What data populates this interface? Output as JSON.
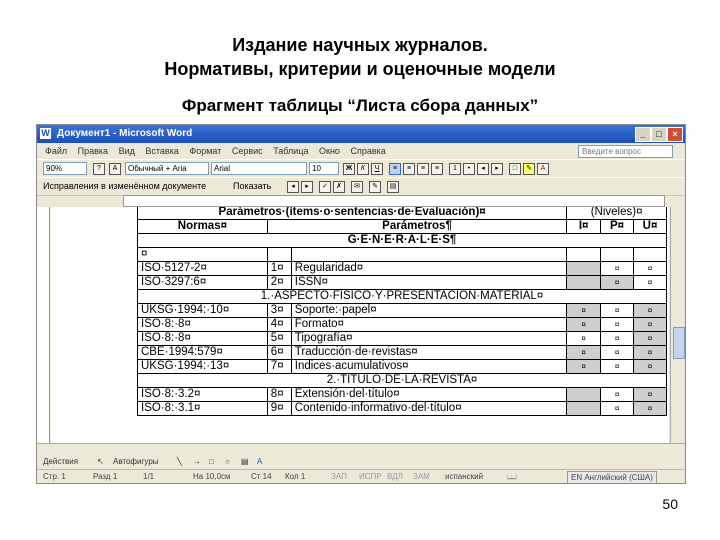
{
  "slide": {
    "title_line1": "Издание научных журналов.",
    "title_line2": "Нормативы, критерии и оценочные модели",
    "subtitle": "Фрагмент таблицы “Листа сбора данных”",
    "page_number": "50"
  },
  "window": {
    "title": "Документ1 - Microsoft Word",
    "btn_min": "_",
    "btn_max": "□",
    "btn_close": "×"
  },
  "menu": [
    "Файл",
    "Правка",
    "Вид",
    "Вставка",
    "Формат",
    "Сервис",
    "Таблица",
    "Окно",
    "Справка"
  ],
  "help_placeholder": "Введите вопрос",
  "toolbar": {
    "zoom": "90%",
    "style": "Обычный + Ariа",
    "font": "Arial",
    "size": "10",
    "track_label": "Исправления в изменённом документе",
    "show_label": "Показать"
  },
  "table": {
    "header1": {
      "params": "Parámetros·(ítems·o·sentencias·de·Evaluación)¤",
      "levels": "(Niveles)¤"
    },
    "header2": {
      "norms": "Normas¤",
      "params": "Parámetros¶",
      "i": "I¤",
      "p": "P¤",
      "u": "U¤"
    },
    "general": "G·E·N·E·R·A·L·E·S¶",
    "rows_a": [
      {
        "norm": "ISO·5127-2¤",
        "num": "1¤",
        "param": "Regularidad¤"
      },
      {
        "norm": "ISO·3297:6¤",
        "num": "2¤",
        "param": "ISSN¤"
      }
    ],
    "section1": "1.·ASPECTO·FISICO·Y·PRESENTACIÓN·MATERIAL¤",
    "rows_b": [
      {
        "norm": "UKSG·1994:·10¤",
        "num": "3¤",
        "param": "Soporte:·papel¤"
      },
      {
        "norm": "ISO·8:·8¤",
        "num": "4¤",
        "param": "Formato¤"
      },
      {
        "norm": "ISO·8:·8¤",
        "num": "5¤",
        "param": "Tipografía¤"
      },
      {
        "norm": "CBE·1994:579¤",
        "num": "6¤",
        "param": "Traducción·de·revistas¤"
      },
      {
        "norm": "UKSG·1994:·13¤",
        "num": "7¤",
        "param": "Indices·acumulativos¤"
      }
    ],
    "section2": "2.·TÍTULO·DE·LA·REVISTA¤",
    "rows_c": [
      {
        "norm": "ISO·8:·3.2¤",
        "num": "8¤",
        "param": "Extensión·del·título¤"
      },
      {
        "norm": "ISO·8:·3.1¤",
        "num": "9¤",
        "param": "Contenido·informativo·del·título¤"
      }
    ],
    "mark": "¤"
  },
  "draw": {
    "actions": "Действия",
    "autoshapes": "Автофигуры"
  },
  "status": {
    "page": "Стр. 1",
    "section": "Разд 1",
    "pages": "1/1",
    "pos": "На 10,0см",
    "line": "Ст 14",
    "col": "Кол 1",
    "rec": "ЗАП",
    "trk": "ИСПР",
    "ext": "ВДЛ",
    "ovr": "ЗАМ",
    "lang_doc": "испанский",
    "lang_kbd": "EN Английский (США)"
  }
}
